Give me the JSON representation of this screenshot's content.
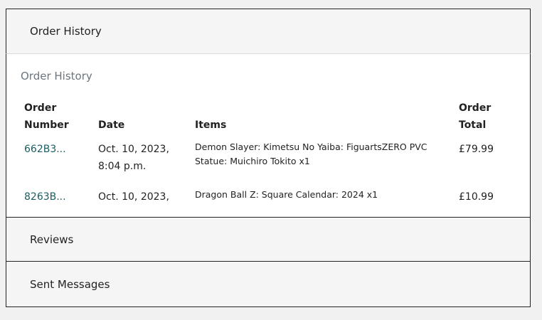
{
  "accordion": {
    "order_history_header": "Order History",
    "reviews_header": "Reviews",
    "messages_header": "Sent Messages"
  },
  "order_history": {
    "title": "Order History",
    "columns": {
      "order_number": [
        "Order",
        "Number"
      ],
      "date": "Date",
      "items": "Items",
      "order_total": [
        "Order",
        "Total"
      ]
    },
    "rows": [
      {
        "order_number": "662B3...",
        "date_line1": "Oct. 10, 2023,",
        "date_line2": "8:04 p.m.",
        "items_line1": "Demon Slayer: Kimetsu No Yaiba: FiguartsZERO PVC",
        "items_line2": "Statue: Muichiro Tokito x1",
        "total": "£79.99"
      },
      {
        "order_number": "8263B...",
        "date_line1": "Oct. 10, 2023,",
        "date_line2": "",
        "items_line1": "Dragon Ball Z: Square Calendar: 2024 x1",
        "items_line2": "",
        "total": "£10.99"
      }
    ]
  },
  "colors": {
    "link": "#1a5e63",
    "muted_title": "#6c757d"
  }
}
